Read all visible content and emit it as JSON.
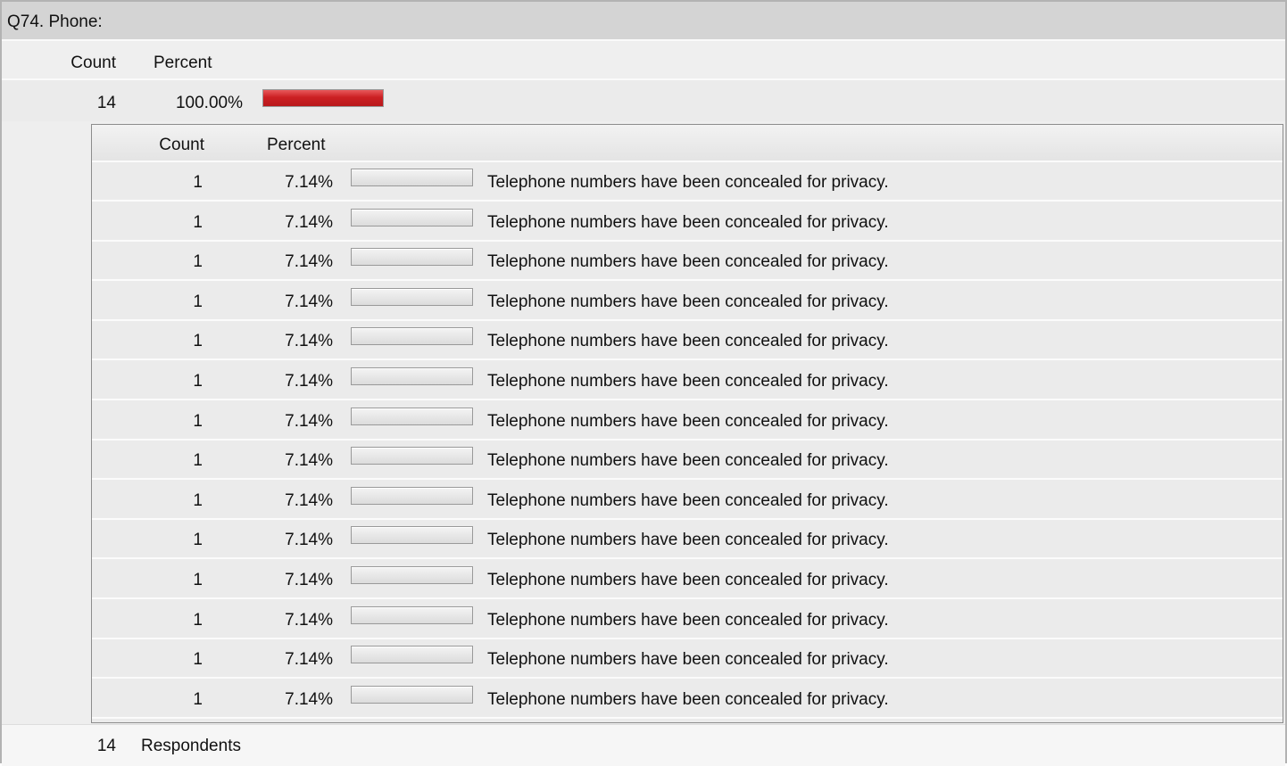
{
  "question": {
    "title": "Q74. Phone:"
  },
  "summary": {
    "headers": {
      "count": "Count",
      "percent": "Percent"
    },
    "row": {
      "count": "14",
      "percent": "100.00%",
      "fill_fraction": 1.0
    },
    "bar_color": "#cc2023"
  },
  "details": {
    "headers": {
      "count": "Count",
      "percent": "Percent"
    },
    "rows": [
      {
        "count": "1",
        "percent": "7.14%",
        "text": "Telephone numbers have been concealed for privacy."
      },
      {
        "count": "1",
        "percent": "7.14%",
        "text": "Telephone numbers have been concealed for privacy."
      },
      {
        "count": "1",
        "percent": "7.14%",
        "text": "Telephone numbers have been concealed for privacy."
      },
      {
        "count": "1",
        "percent": "7.14%",
        "text": "Telephone numbers have been concealed for privacy."
      },
      {
        "count": "1",
        "percent": "7.14%",
        "text": "Telephone numbers have been concealed for privacy."
      },
      {
        "count": "1",
        "percent": "7.14%",
        "text": "Telephone numbers have been concealed for privacy."
      },
      {
        "count": "1",
        "percent": "7.14%",
        "text": "Telephone numbers have been concealed for privacy."
      },
      {
        "count": "1",
        "percent": "7.14%",
        "text": "Telephone numbers have been concealed for privacy."
      },
      {
        "count": "1",
        "percent": "7.14%",
        "text": "Telephone numbers have been concealed for privacy."
      },
      {
        "count": "1",
        "percent": "7.14%",
        "text": "Telephone numbers have been concealed for privacy."
      },
      {
        "count": "1",
        "percent": "7.14%",
        "text": "Telephone numbers have been concealed for privacy."
      },
      {
        "count": "1",
        "percent": "7.14%",
        "text": "Telephone numbers have been concealed for privacy."
      },
      {
        "count": "1",
        "percent": "7.14%",
        "text": "Telephone numbers have been concealed for privacy."
      },
      {
        "count": "1",
        "percent": "7.14%",
        "text": "Telephone numbers have been concealed for privacy."
      }
    ],
    "bar_fill_fraction": 0.0
  },
  "footer": {
    "count": "14",
    "label": "Respondents"
  }
}
